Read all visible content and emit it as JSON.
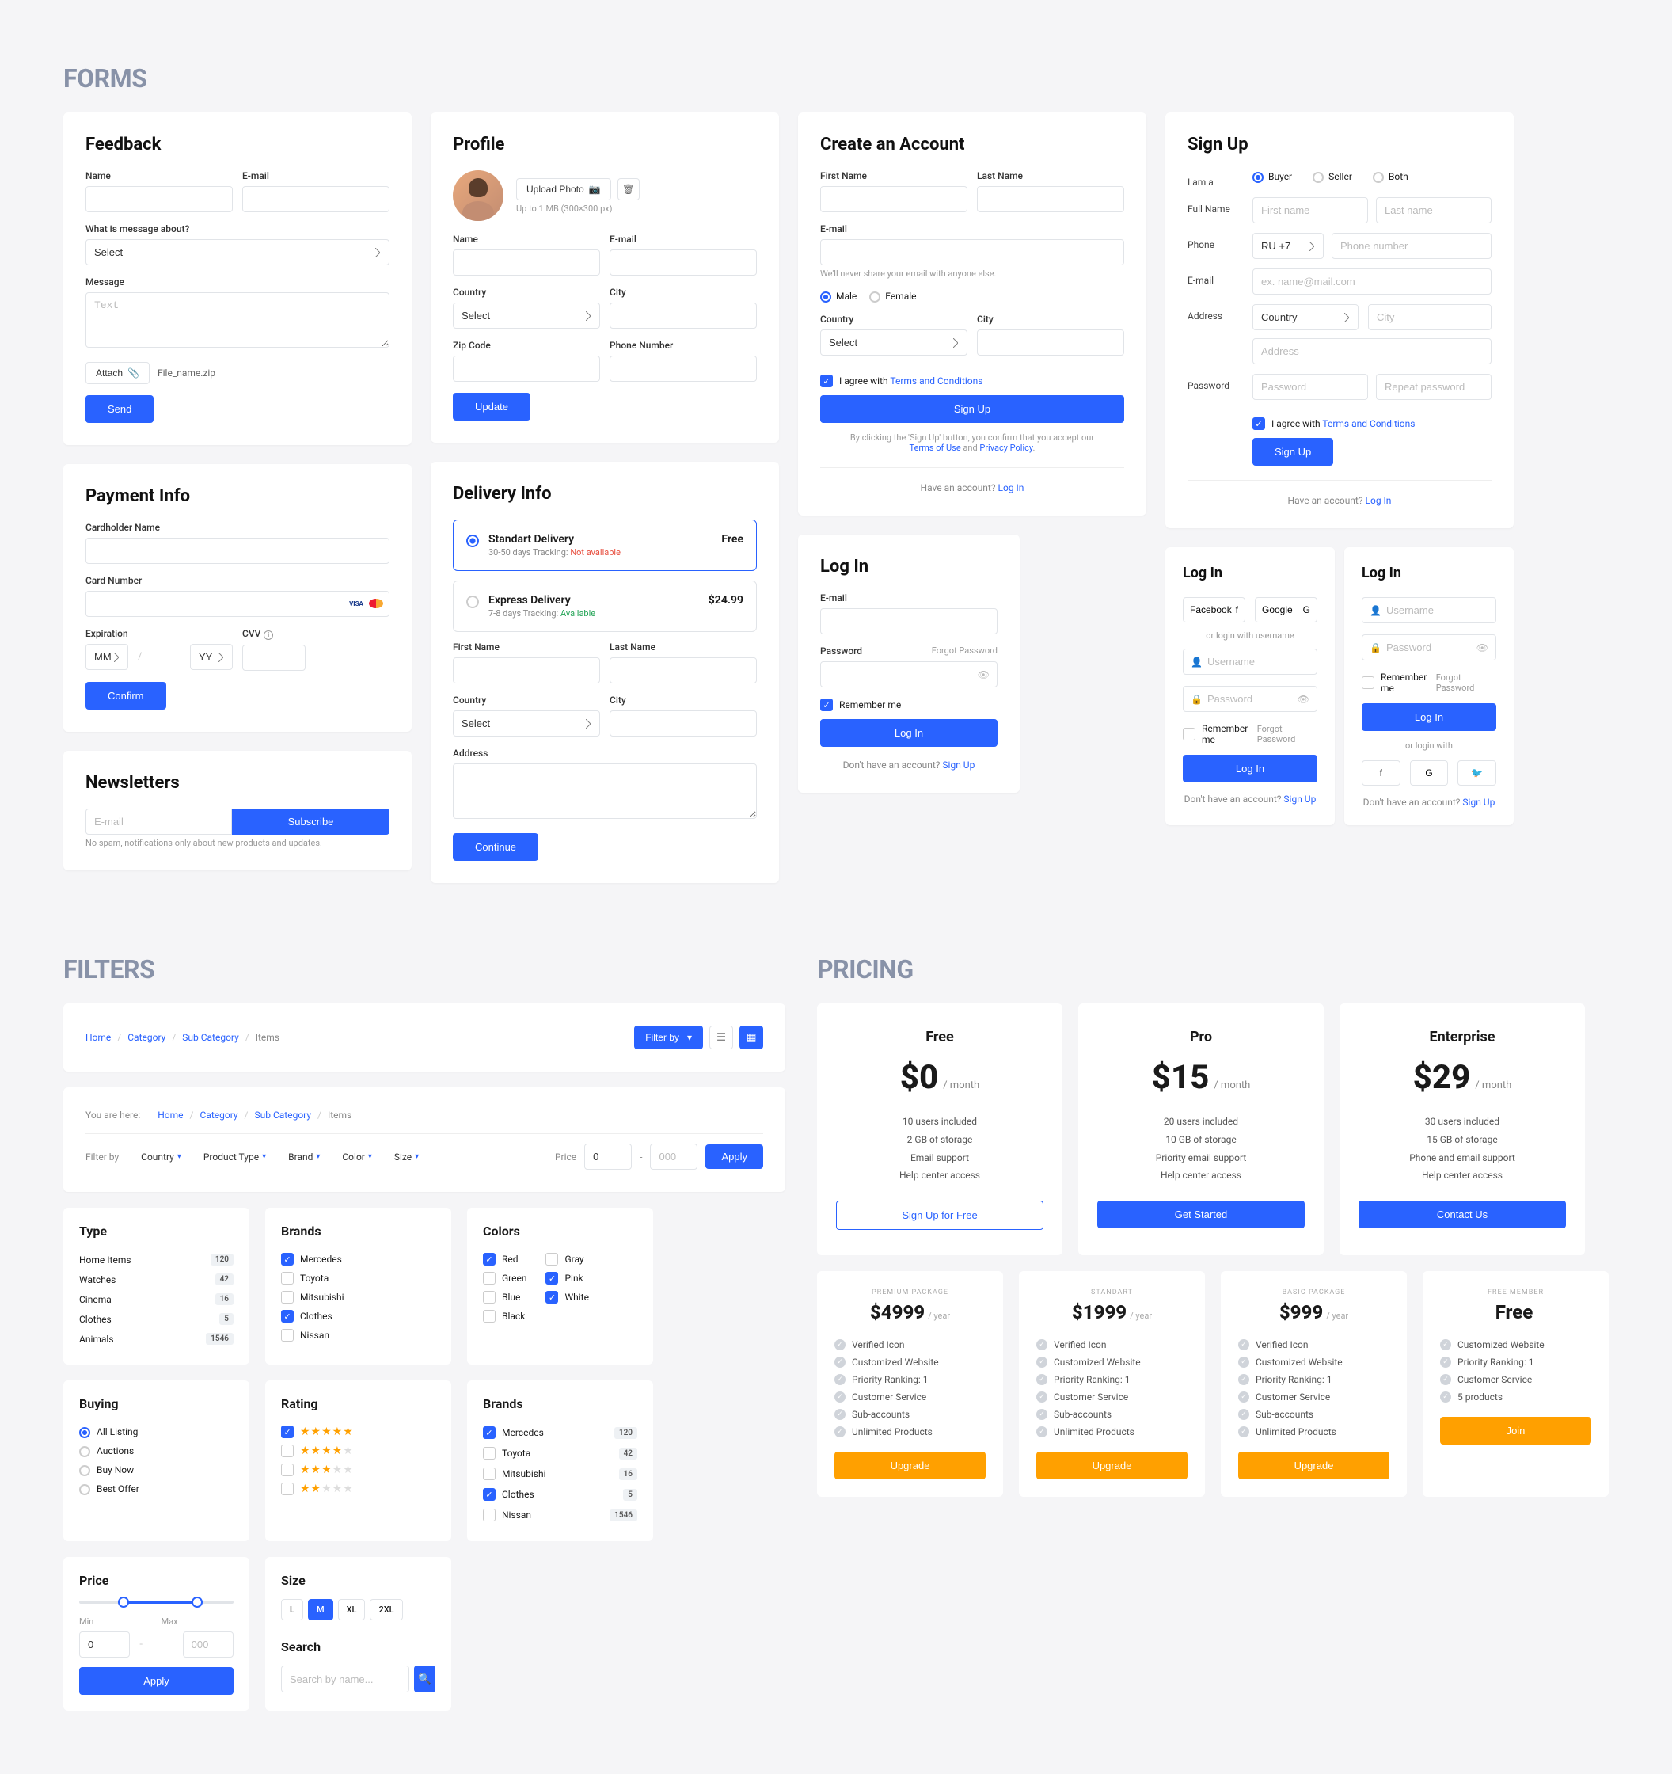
{
  "titles": {
    "forms": "FORMS",
    "filters": "FILTERS",
    "pricing": "PRICING"
  },
  "feedback": {
    "title": "Feedback",
    "name": "Name",
    "email": "E-mail",
    "about": "What is message about?",
    "select": "Select",
    "message": "Message",
    "text_ph": "Text",
    "attach": "Attach",
    "filename": "File_name.zip",
    "send": "Send"
  },
  "profile": {
    "title": "Profile",
    "upload": "Upload Photo",
    "hint": "Up to 1 MB (300×300 px)",
    "name": "Name",
    "email": "E-mail",
    "country": "Country",
    "select": "Select",
    "city": "City",
    "zip": "Zip Code",
    "phone": "Phone Number",
    "update": "Update"
  },
  "account": {
    "title": "Create an Account",
    "fname": "First Name",
    "lname": "Last Name",
    "email": "E-mail",
    "email_hint": "We'll never share your email with anyone else.",
    "male": "Male",
    "female": "Female",
    "country": "Country",
    "select": "Select",
    "city": "City",
    "agree_pre": "I agree with ",
    "terms": "Terms and Conditions",
    "signup": "Sign Up",
    "byclick": "By clicking the 'Sign Up' button, you confirm that you accept our",
    "tou": "Terms of Use",
    "and": " and ",
    "pp": "Privacy Policy",
    "have": "Have an account? ",
    "login": "Log In"
  },
  "signup": {
    "title": "Sign Up",
    "iam": "I am a",
    "buyer": "Buyer",
    "seller": "Seller",
    "both": "Both",
    "fullname": "Full Name",
    "fn_ph": "First name",
    "ln_ph": "Last name",
    "phone": "Phone",
    "code": "RU +7",
    "pn_ph": "Phone number",
    "email": "E-mail",
    "email_ph": "ex. name@mail.com",
    "address": "Address",
    "country_ph": "Country",
    "city_ph": "City",
    "addr_ph": "Address",
    "password": "Password",
    "pw_ph": "Password",
    "rp_ph": "Repeat password",
    "agree_pre": "I agree with ",
    "terms": "Terms and Conditions",
    "signup": "Sign Up",
    "have": "Have an account? ",
    "login": "Log In"
  },
  "payment": {
    "title": "Payment Info",
    "cardholder": "Cardholder Name",
    "cardnum": "Card Number",
    "exp": "Expiration",
    "mm": "MM",
    "yy": "YY",
    "cvv": "CVV",
    "confirm": "Confirm"
  },
  "delivery": {
    "title": "Delivery Info",
    "std": "Standart Delivery",
    "std_sub": "30-50 days   Tracking: ",
    "std_track": "Not available",
    "std_price": "Free",
    "exp": "Express Delivery",
    "exp_sub": "7-8 days   Tracking: ",
    "exp_track": "Available",
    "exp_price": "$24.99",
    "fname": "First Name",
    "lname": "Last Name",
    "country": "Country",
    "select": "Select",
    "city": "City",
    "address": "Address",
    "continue": "Continue"
  },
  "newsletters": {
    "title": "Newsletters",
    "ph": "E-mail",
    "btn": "Subscribe",
    "hint": "No spam, notifications only about new products and updates."
  },
  "login1": {
    "title": "Log In",
    "email": "E-mail",
    "password": "Password",
    "forgot": "Forgot Password",
    "remember": "Remember me",
    "login": "Log In",
    "nohave": "Don't have an account? ",
    "signup": "Sign Up"
  },
  "login2": {
    "title": "Log In",
    "fb": "Facebook",
    "gg": "Google",
    "or": "or login with username",
    "un_ph": "Username",
    "pw_ph": "Password",
    "remember": "Remember me",
    "forgot": "Forgot Password",
    "login": "Log In",
    "nohave": "Don't have an account? ",
    "signup": "Sign Up"
  },
  "login3": {
    "title": "Log In",
    "un_ph": "Username",
    "pw_ph": "Password",
    "remember": "Remember me",
    "forgot": "Forgot Password",
    "login": "Log In",
    "or": "or login with",
    "nohave": "Don't have an account? ",
    "signup": "Sign Up"
  },
  "bc": {
    "home": "Home",
    "cat": "Category",
    "sub": "Sub Category",
    "items": "Items",
    "here": "You are here:",
    "filterby": "Filter by"
  },
  "fbar": {
    "filterby": "Filter by",
    "country": "Country",
    "ptype": "Product Type",
    "brand": "Brand",
    "color": "Color",
    "size": "Size",
    "price": "Price",
    "apply": "Apply",
    "zero": "0",
    "ph000": "000"
  },
  "ftype": {
    "title": "Type",
    "r": [
      [
        "Home Items",
        "120"
      ],
      [
        "Watches",
        "42"
      ],
      [
        "Cinema",
        "16"
      ],
      [
        "Clothes",
        "5"
      ],
      [
        "Animals",
        "1546"
      ]
    ]
  },
  "fbrands1": {
    "title": "Brands",
    "r": [
      [
        "Mercedes",
        true
      ],
      [
        "Toyota",
        false
      ],
      [
        "Mitsubishi",
        false
      ],
      [
        "Clothes",
        true
      ],
      [
        "Nissan",
        false
      ]
    ]
  },
  "fcolors": {
    "title": "Colors",
    "left": [
      [
        "Red",
        true
      ],
      [
        "Green",
        false
      ],
      [
        "Blue",
        false
      ],
      [
        "Black",
        false
      ]
    ],
    "right": [
      [
        "Gray",
        false
      ],
      [
        "Pink",
        true
      ],
      [
        "White",
        true
      ]
    ]
  },
  "fbuying": {
    "title": "Buying",
    "r": [
      [
        "All Listing",
        true
      ],
      [
        "Auctions",
        false
      ],
      [
        "Buy Now",
        false
      ],
      [
        "Best Offer",
        false
      ]
    ]
  },
  "frating": {
    "title": "Rating",
    "five": "★★★★★",
    "four": "★★★★",
    "three": "★★★",
    "two": "★★"
  },
  "fbrands2": {
    "title": "Brands",
    "r": [
      [
        "Mercedes",
        true,
        "120"
      ],
      [
        "Toyota",
        false,
        "42"
      ],
      [
        "Mitsubishi",
        false,
        "16"
      ],
      [
        "Clothes",
        true,
        "5"
      ],
      [
        "Nissan",
        false,
        "1546"
      ]
    ]
  },
  "fprice": {
    "title": "Price",
    "min": "Min",
    "max": "Max",
    "zero": "0",
    "ph": "000",
    "apply": "Apply"
  },
  "fsize": {
    "title": "Size",
    "chips": [
      "L",
      "M",
      "XL",
      "2XL"
    ]
  },
  "fsearch": {
    "title": "Search",
    "ph": "Search by name..."
  },
  "plans": [
    {
      "name": "Free",
      "price": "$0",
      "period": "/ month",
      "feats": [
        "10 users included",
        "2 GB of storage",
        "Email support",
        "Help center access"
      ],
      "cta": "Sign Up for Free",
      "outline": true
    },
    {
      "name": "Pro",
      "price": "$15",
      "period": "/ month",
      "feats": [
        "20 users included",
        "10 GB of storage",
        "Priority email support",
        "Help center access"
      ],
      "cta": "Get Started"
    },
    {
      "name": "Enterprise",
      "price": "$29",
      "period": "/ month",
      "feats": [
        "30 users included",
        "15 GB of storage",
        "Phone and email support",
        "Help center access"
      ],
      "cta": "Contact Us"
    }
  ],
  "plans2": [
    {
      "tag": "PREMIUM PACKAGE",
      "amt": "$4999",
      "per": "/ year",
      "feats": [
        "Verified Icon",
        "Customized Website",
        "Priority Ranking: 1",
        "Customer Service",
        "Sub-accounts",
        "Unlimited Products"
      ],
      "cta": "Upgrade"
    },
    {
      "tag": "STANDART",
      "amt": "$1999",
      "per": "/ year",
      "feats": [
        "Verified Icon",
        "Customized Website",
        "Priority Ranking: 1",
        "Customer Service",
        "Sub-accounts",
        "Unlimited Products"
      ],
      "cta": "Upgrade"
    },
    {
      "tag": "BASIC PACKAGE",
      "amt": "$999",
      "per": "/ year",
      "feats": [
        "Verified Icon",
        "Customized Website",
        "Priority Ranking: 1",
        "Customer Service",
        "Sub-accounts",
        "Unlimited Products"
      ],
      "cta": "Upgrade"
    },
    {
      "tag": "FREE MEMBER",
      "amt": "Free",
      "per": "",
      "feats": [
        "Customized Website",
        "Priority Ranking: 1",
        "Customer Service",
        "5 products"
      ],
      "cta": "Join"
    }
  ]
}
